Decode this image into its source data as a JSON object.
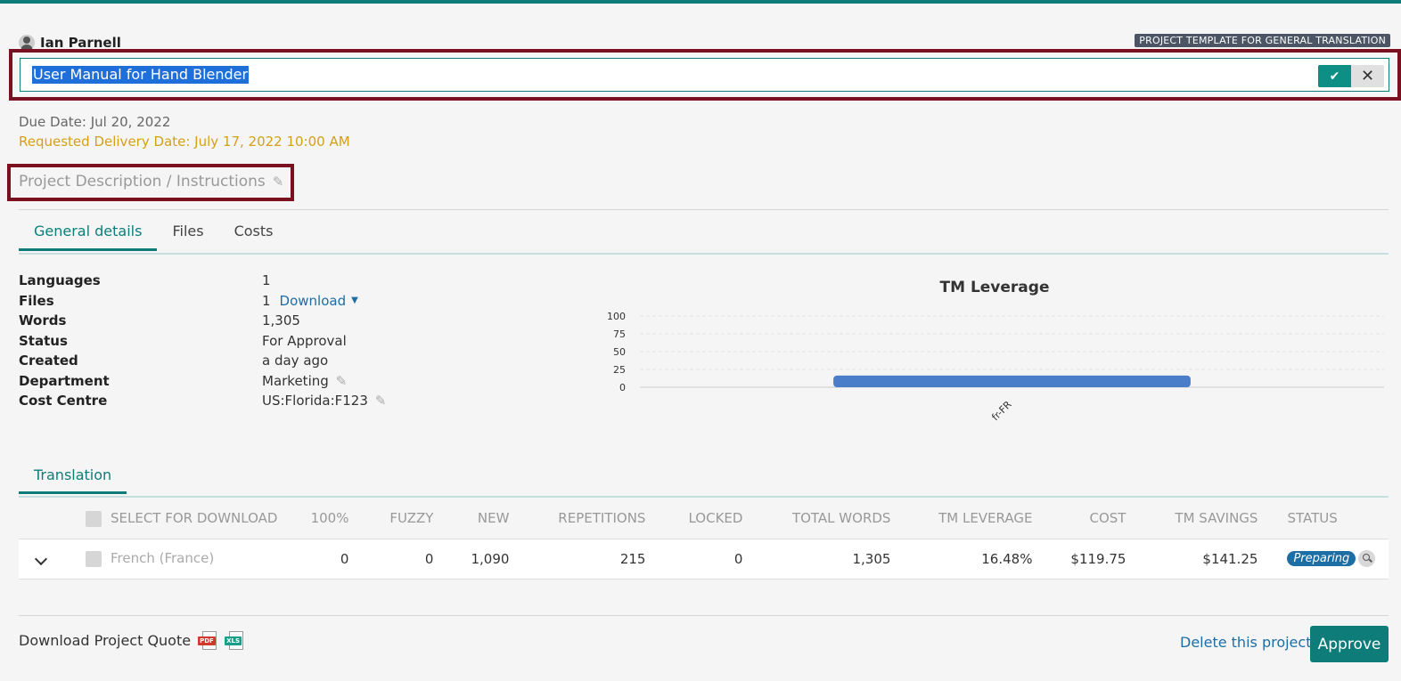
{
  "header": {
    "user_name": "Ian Parnell",
    "template_badge": "PROJECT TEMPLATE FOR GENERAL TRANSLATION",
    "title_value": "User Manual for Hand Blender",
    "confirm_icon": "check-icon",
    "cancel_icon": "close-icon"
  },
  "dates": {
    "due": "Due Date: Jul 20, 2022",
    "requested": "Requested Delivery Date: July 17, 2022 10:00 AM"
  },
  "description": {
    "placeholder": "Project Description / Instructions",
    "edit_icon": "pencil-icon"
  },
  "tabs": [
    {
      "label": "General details",
      "active": true
    },
    {
      "label": "Files",
      "active": false
    },
    {
      "label": "Costs",
      "active": false
    }
  ],
  "details": {
    "languages": {
      "label": "Languages",
      "value": "1"
    },
    "files": {
      "label": "Files",
      "value": "1",
      "link": "Download"
    },
    "words": {
      "label": "Words",
      "value": "1,305"
    },
    "status": {
      "label": "Status",
      "value": "For Approval"
    },
    "created": {
      "label": "Created",
      "value": "a day ago"
    },
    "department": {
      "label": "Department",
      "value": "Marketing"
    },
    "cost_centre": {
      "label": "Cost Centre",
      "value": "US:Florida:F123"
    }
  },
  "chart_data": {
    "type": "bar",
    "title": "TM Leverage",
    "categories": [
      "fr-FR"
    ],
    "values": [
      16.48
    ],
    "yticks": [
      "100",
      "75",
      "50",
      "25",
      "0"
    ],
    "ylim": [
      0,
      100
    ],
    "color": "#4a7ec8",
    "grid": true
  },
  "section_tab": "Translation",
  "table": {
    "headers": {
      "select": "SELECT FOR DOWNLOAD",
      "p100": "100%",
      "fuzzy": "FUZZY",
      "new": "NEW",
      "repetitions": "REPETITIONS",
      "locked": "LOCKED",
      "total_words": "TOTAL WORDS",
      "tm_leverage": "TM LEVERAGE",
      "cost": "COST",
      "tm_savings": "TM SAVINGS",
      "status": "STATUS"
    },
    "row": {
      "language": "French (France)",
      "p100": "0",
      "fuzzy": "0",
      "new": "1,090",
      "repetitions": "215",
      "locked": "0",
      "total_words": "1,305",
      "tm_leverage": "16.48%",
      "cost": "$119.75",
      "tm_savings": "$141.25",
      "status": "Preparing"
    }
  },
  "footer": {
    "quote_label": "Download Project Quote",
    "pdf": "PDF",
    "xls": "XLS",
    "delete": "Delete this project",
    "approve": "Approve"
  }
}
